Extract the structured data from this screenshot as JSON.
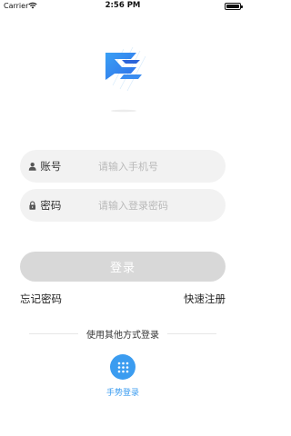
{
  "status_bar": {
    "carrier": "Carrier",
    "time": "2:56 PM",
    "battery_level": 1.0
  },
  "logo": {
    "icon": "app-logo-icon"
  },
  "account_field": {
    "label": "账号",
    "placeholder": "请输入手机号",
    "icon": "user-icon"
  },
  "password_field": {
    "label": "密码",
    "placeholder": "请输入登录密码",
    "icon": "lock-icon"
  },
  "login_button": {
    "label": "登录",
    "disabled": true
  },
  "links": {
    "forgot_password": "忘记密码",
    "quick_register": "快速注册"
  },
  "alt_login": {
    "divider_text": "使用其他方式登录",
    "gesture_label": "手势登录",
    "gesture_icon": "grid-dots-icon"
  },
  "colors": {
    "accent": "#3b9cf0",
    "button_disabled": "#d8d8d8",
    "field_bg": "#f2f2f2"
  }
}
